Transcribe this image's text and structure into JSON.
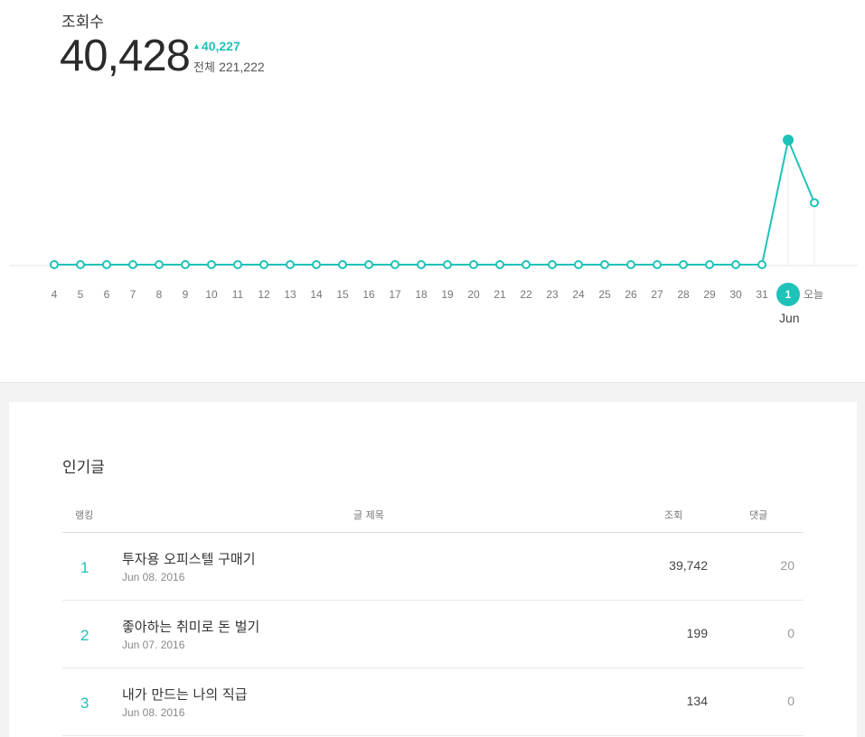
{
  "stats": {
    "title": "조회수",
    "count": "40,428",
    "delta": "40,227",
    "total_label": "전체",
    "total_value": "221,222"
  },
  "chart_data": {
    "type": "line",
    "x": [
      "4",
      "5",
      "6",
      "7",
      "8",
      "9",
      "10",
      "11",
      "12",
      "13",
      "14",
      "15",
      "16",
      "17",
      "18",
      "19",
      "20",
      "21",
      "22",
      "23",
      "24",
      "25",
      "26",
      "27",
      "28",
      "29",
      "30",
      "31",
      "1",
      "오늘"
    ],
    "values": [
      2,
      2,
      2,
      2,
      3,
      3,
      4,
      10,
      4,
      4,
      5,
      3,
      4,
      4,
      3,
      3,
      4,
      4,
      2,
      4,
      4,
      4,
      3,
      3,
      4,
      4,
      4,
      4,
      40227,
      20000
    ],
    "highlight_index": 28,
    "month_label": "Jun",
    "color": "#1ec2b8"
  },
  "popular": {
    "title": "인기글",
    "headers": {
      "rank": "랭킹",
      "title": "글 제목",
      "views": "조회",
      "comments": "댓글"
    },
    "rows": [
      {
        "rank": "1",
        "title": "투자용 오피스텔 구매기",
        "date": "Jun 08. 2016",
        "views": "39,742",
        "comments": "20"
      },
      {
        "rank": "2",
        "title": "좋아하는 취미로 돈 벌기",
        "date": "Jun 07. 2016",
        "views": "199",
        "comments": "0"
      },
      {
        "rank": "3",
        "title": "내가 만드는 나의 직급",
        "date": "Jun 08. 2016",
        "views": "134",
        "comments": "0"
      }
    ]
  }
}
